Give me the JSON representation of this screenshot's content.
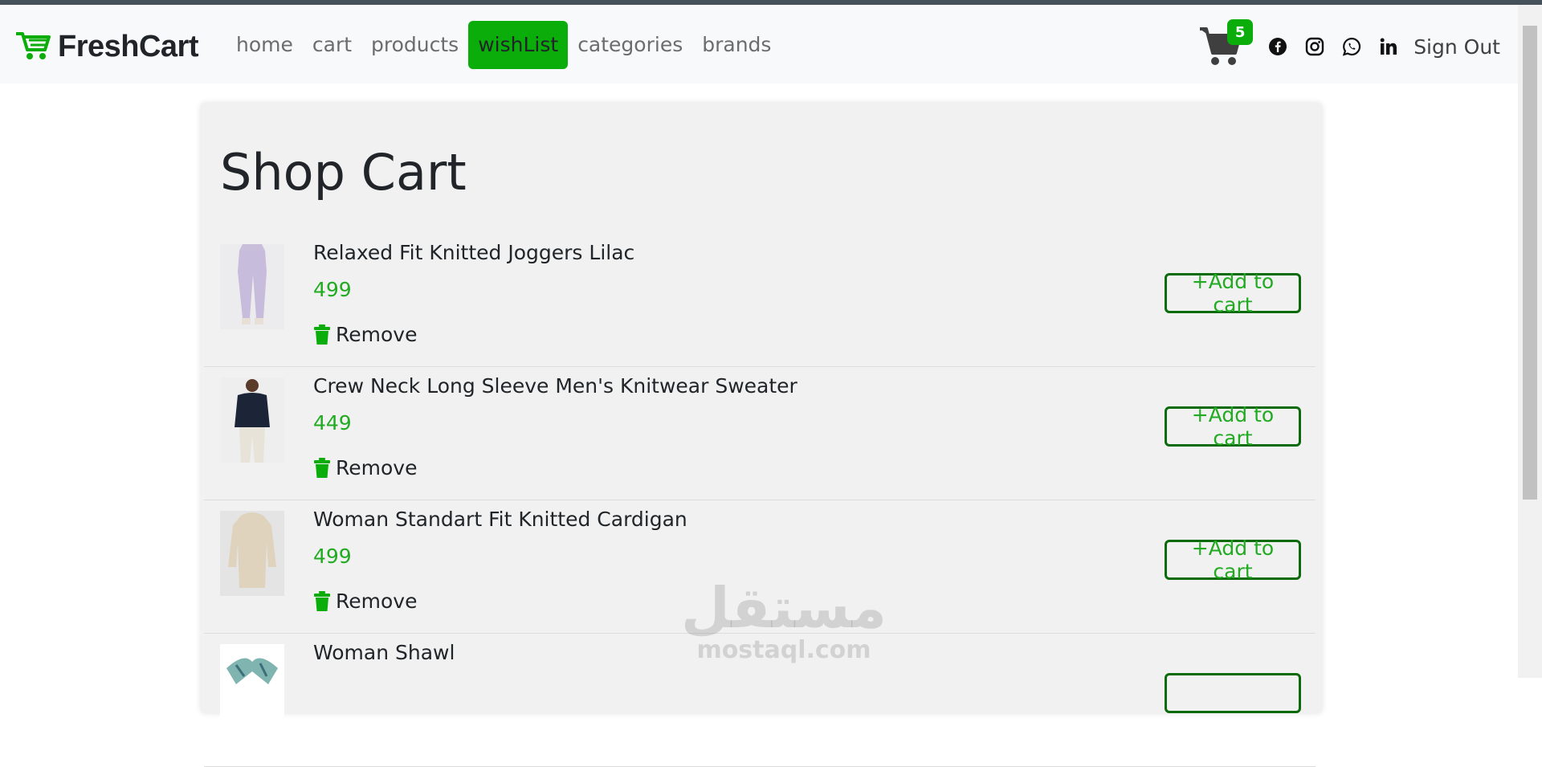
{
  "brand": {
    "name": "FreshCart"
  },
  "nav": {
    "links": [
      {
        "label": "home"
      },
      {
        "label": "cart"
      },
      {
        "label": "products"
      },
      {
        "label": "wishList",
        "active": true
      },
      {
        "label": "categories"
      },
      {
        "label": "brands"
      }
    ],
    "cart_count": "5",
    "social_icons": [
      "facebook-icon",
      "instagram-icon",
      "whatsapp-icon",
      "linkedin-icon"
    ],
    "signout_label": "Sign Out"
  },
  "page": {
    "title": "Shop Cart"
  },
  "items": [
    {
      "title": "Relaxed Fit Knitted Joggers Lilac",
      "price": "499",
      "remove_label": "Remove",
      "add_label": "+Add to cart"
    },
    {
      "title": "Crew Neck Long Sleeve Men's Knitwear Sweater",
      "price": "449",
      "remove_label": "Remove",
      "add_label": "+Add to cart"
    },
    {
      "title": "Woman Standart Fit Knitted Cardigan",
      "price": "499",
      "remove_label": "Remove",
      "add_label": "+Add to cart"
    },
    {
      "title": "Woman Shawl",
      "price": "",
      "remove_label": "",
      "add_label": ""
    }
  ],
  "watermark": {
    "arabic": "مستقل",
    "latin": "mostaql.com"
  },
  "colors": {
    "accent": "#0aad0a",
    "price": "#22aa22",
    "button_border": "#0b6b0b",
    "panel": "#f0f1f0"
  }
}
